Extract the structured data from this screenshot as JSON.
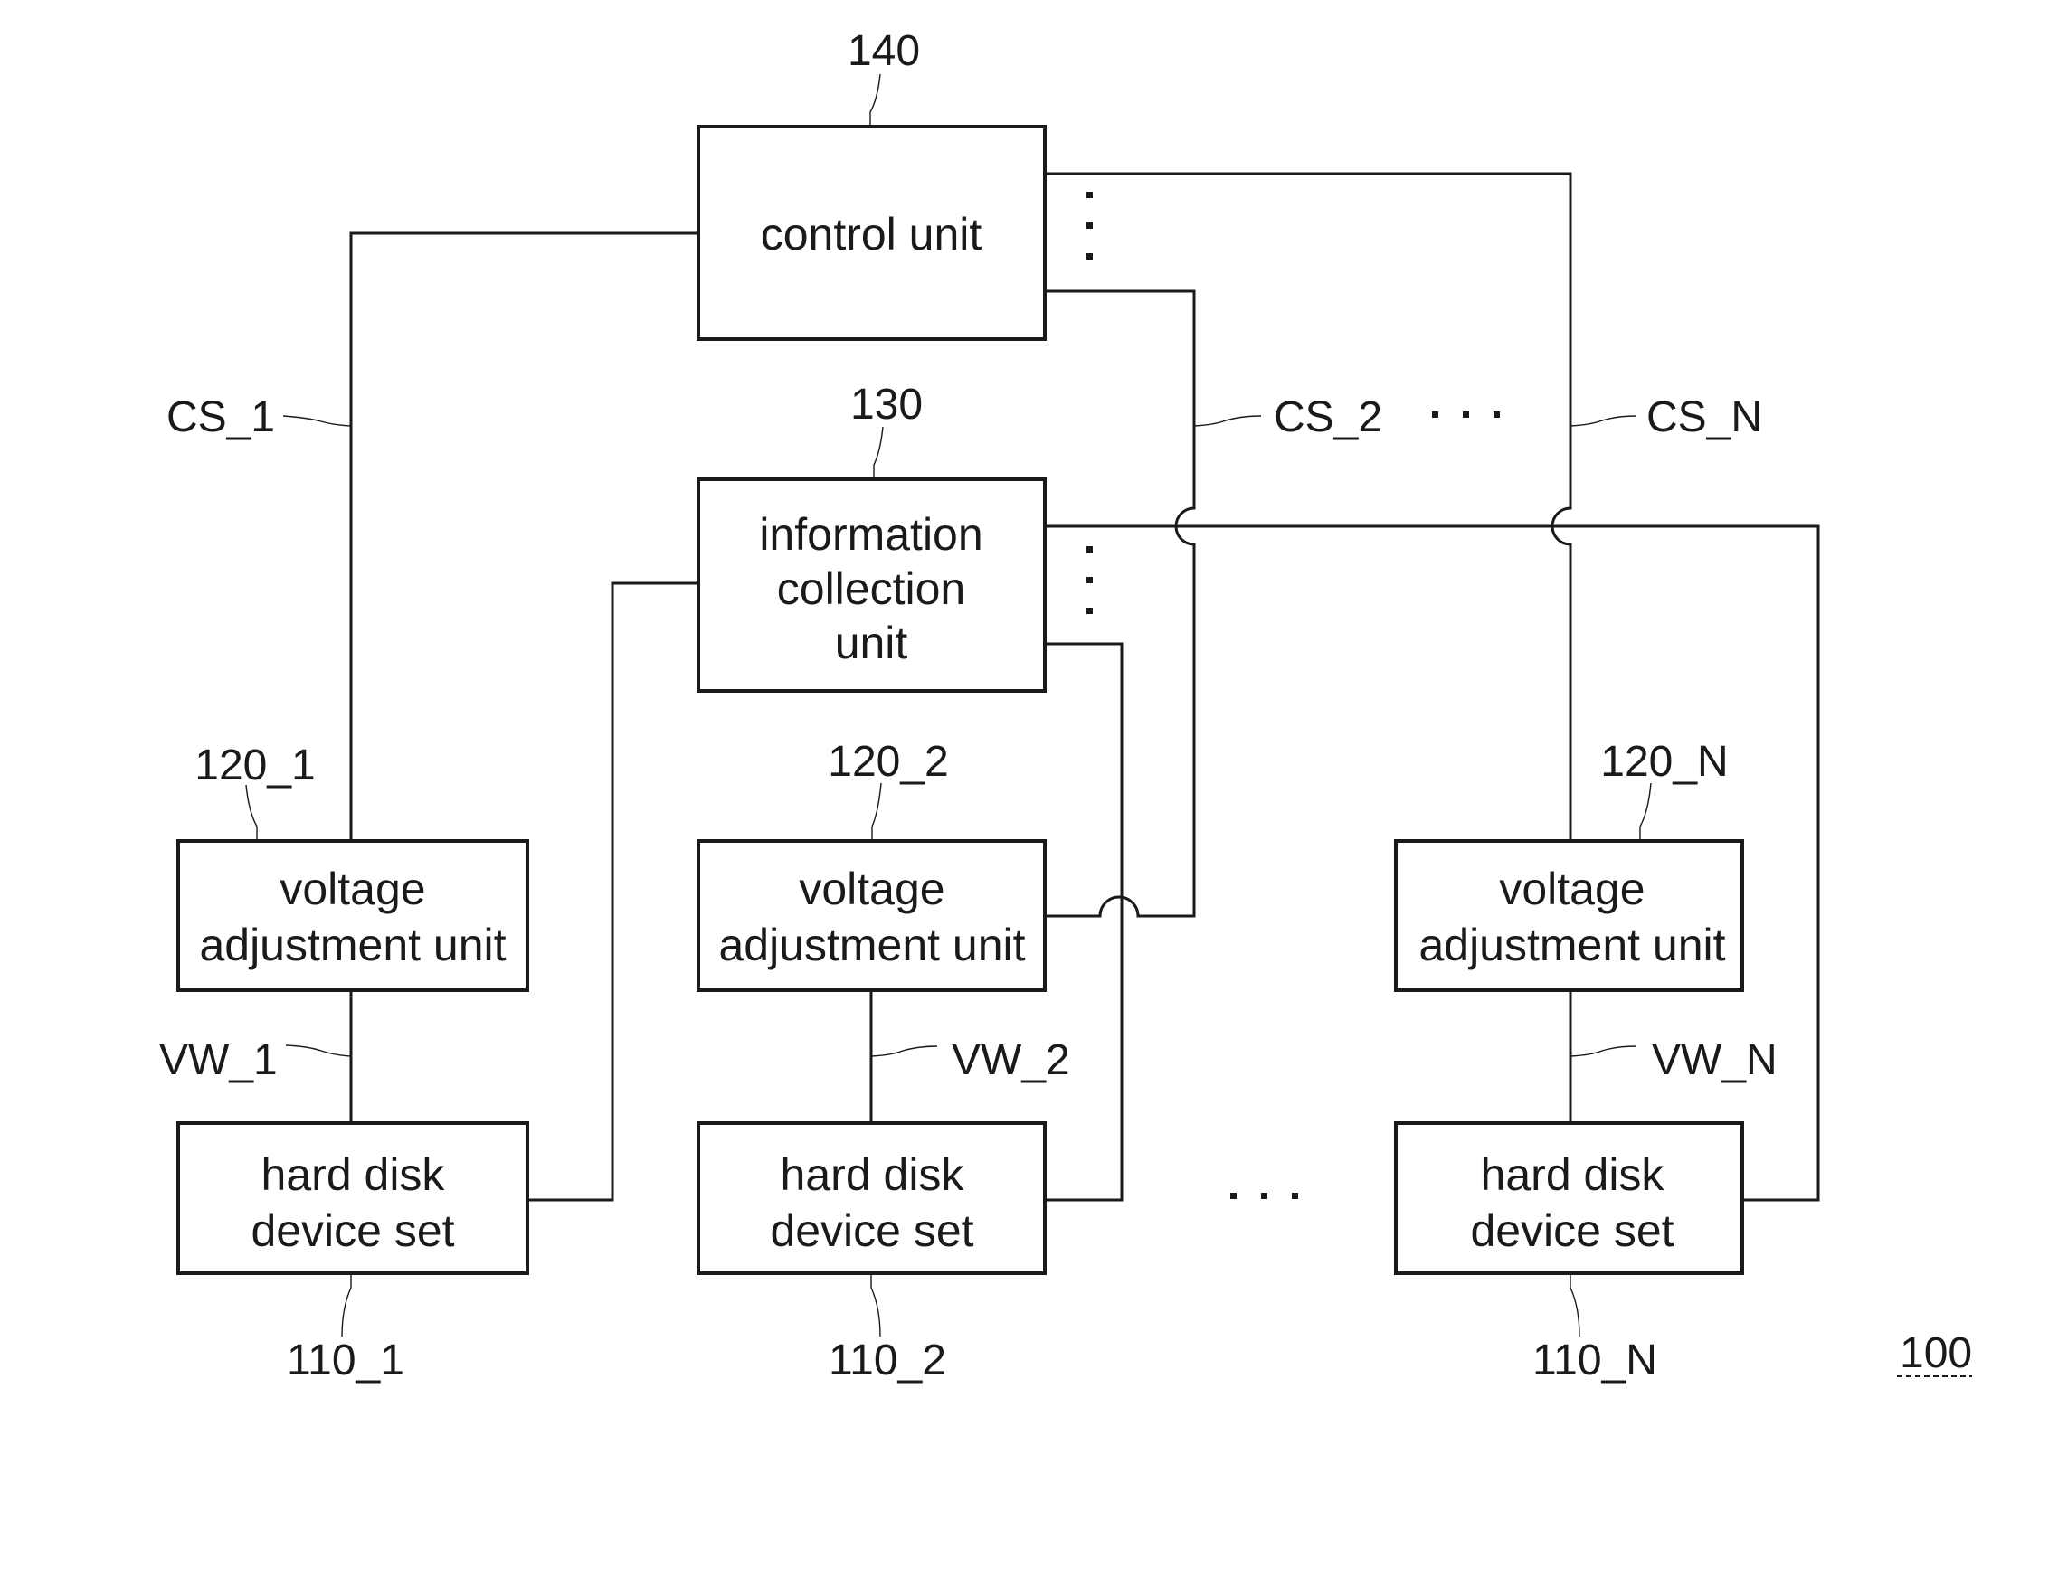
{
  "diagram": {
    "figure_ref": "100",
    "blocks": {
      "control_unit": {
        "label": "control unit",
        "ref": "140"
      },
      "info_collection": {
        "lines": [
          "information",
          "collection",
          "unit"
        ],
        "ref": "130"
      },
      "voltage_units": [
        {
          "lines": [
            "voltage",
            "adjustment unit"
          ],
          "ref": "120_1"
        },
        {
          "lines": [
            "voltage",
            "adjustment unit"
          ],
          "ref": "120_2"
        },
        {
          "lines": [
            "voltage",
            "adjustment unit"
          ],
          "ref": "120_N"
        }
      ],
      "hard_disk_sets": [
        {
          "lines": [
            "hard disk",
            "device set"
          ],
          "ref": "110_1"
        },
        {
          "lines": [
            "hard disk",
            "device set"
          ],
          "ref": "110_2"
        },
        {
          "lines": [
            "hard disk",
            "device set"
          ],
          "ref": "110_N"
        }
      ]
    },
    "signals": {
      "control": [
        "CS_1",
        "CS_2",
        "CS_N"
      ],
      "voltage": [
        "VW_1",
        "VW_2",
        "VW_N"
      ]
    },
    "ellipsis": "..."
  }
}
